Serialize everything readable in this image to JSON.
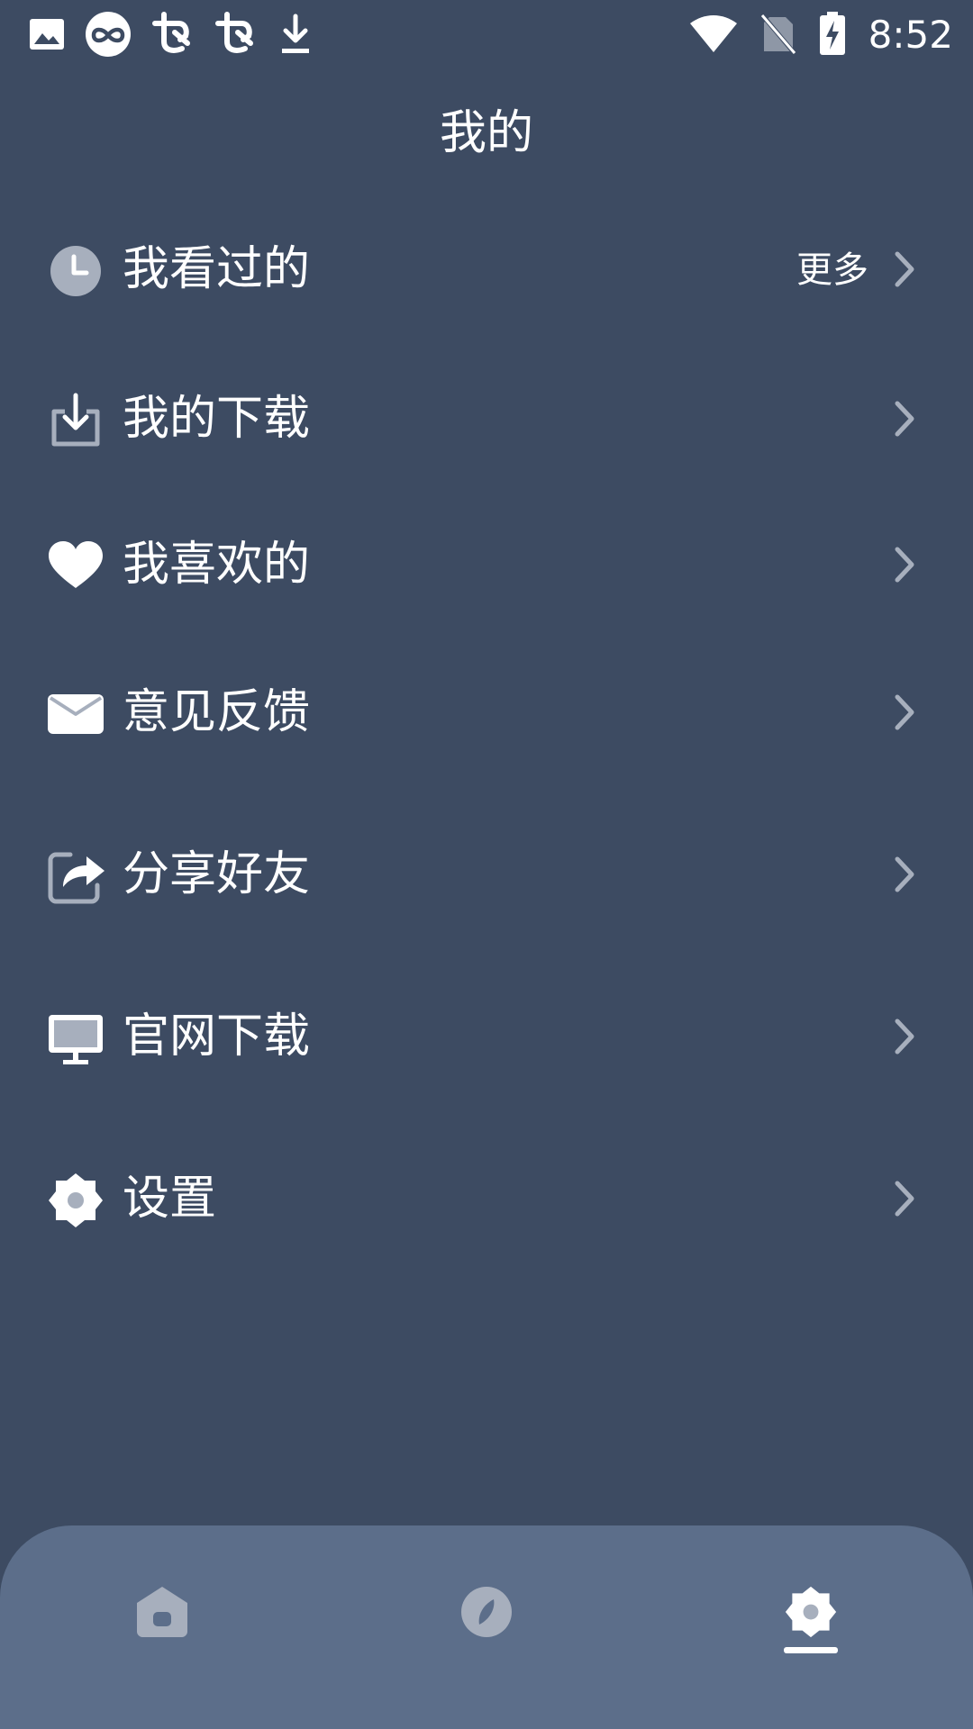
{
  "status_bar": {
    "time": "8:52",
    "icons_left": [
      "image-icon",
      "infinity-icon",
      "app-icon-1",
      "app-icon-2",
      "download-icon"
    ],
    "icons_right": [
      "wifi-icon",
      "no-sim-icon",
      "battery-charging-icon"
    ]
  },
  "header": {
    "title": "我的"
  },
  "menu": {
    "items": [
      {
        "label": "我看过的",
        "icon": "clock-icon",
        "more": "更多"
      },
      {
        "label": "我的下载",
        "icon": "download-box-icon"
      },
      {
        "label": "我喜欢的",
        "icon": "heart-icon"
      },
      {
        "label": "意见反馈",
        "icon": "envelope-icon"
      },
      {
        "label": "分享好友",
        "icon": "share-icon"
      },
      {
        "label": "官网下载",
        "icon": "monitor-icon"
      },
      {
        "label": "设置",
        "icon": "gear-icon"
      }
    ]
  },
  "bottom_nav": {
    "tabs": [
      {
        "icon": "home-icon",
        "active": false
      },
      {
        "icon": "compass-icon",
        "active": false
      },
      {
        "icon": "gear-icon",
        "active": true
      }
    ]
  },
  "colors": {
    "background": "#3d4b62",
    "nav_background": "#5c6e8a",
    "icon_muted": "#a7afbd",
    "text": "#ffffff"
  }
}
